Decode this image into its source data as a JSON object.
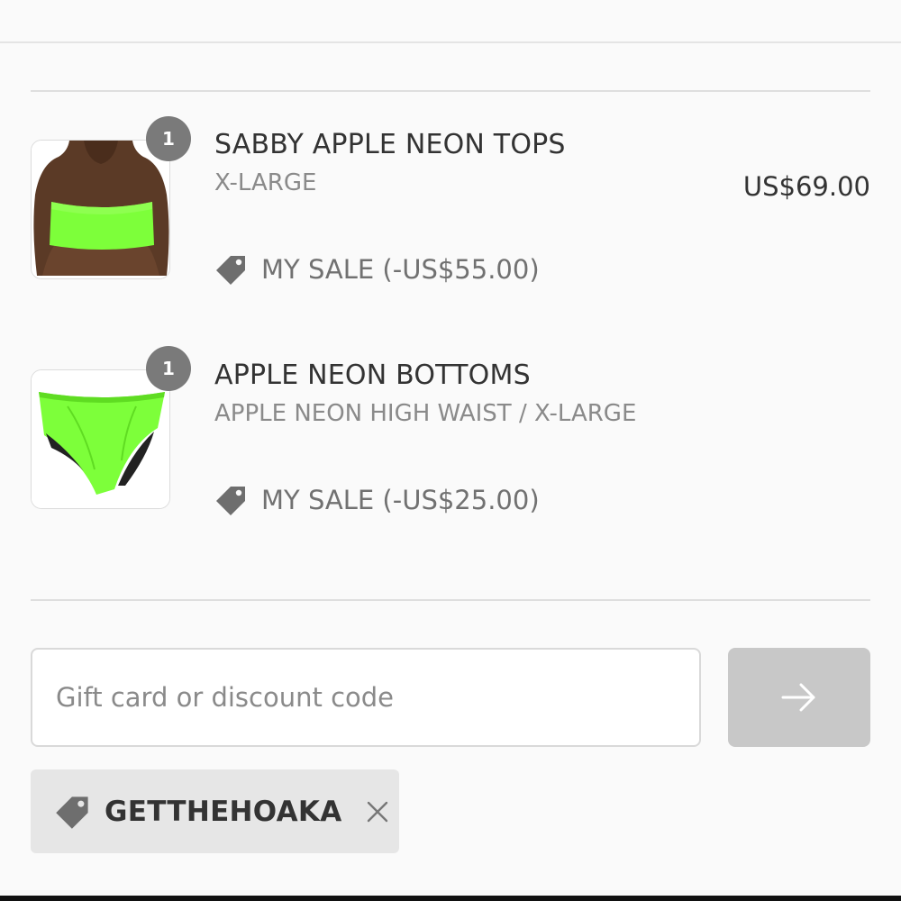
{
  "line_items": [
    {
      "quantity": "1",
      "title": "SABBY APPLE NEON TOPS",
      "variant": "X-LARGE",
      "price": "US$69.00",
      "discount": "MY SALE (-US$55.00)",
      "image_icon": "neon-bandeau-top-image"
    },
    {
      "quantity": "1",
      "title": "APPLE NEON BOTTOMS",
      "variant": "APPLE NEON HIGH WAIST / X-LARGE",
      "price": "",
      "discount": "MY SALE (-US$25.00)",
      "image_icon": "neon-high-waist-bottom-image"
    }
  ],
  "discount_form": {
    "placeholder": "Gift card or discount code",
    "value": "",
    "apply_icon": "arrow-right-icon"
  },
  "applied_code": {
    "label": "GETTHEHOAKA",
    "icon": "tag-icon",
    "remove_icon": "close-icon"
  },
  "colors": {
    "neon_green": "#7dff3a",
    "badge_gray": "#7a7a7a",
    "button_disabled": "#c8c8c8",
    "chip_bg": "#e6e6e6"
  }
}
